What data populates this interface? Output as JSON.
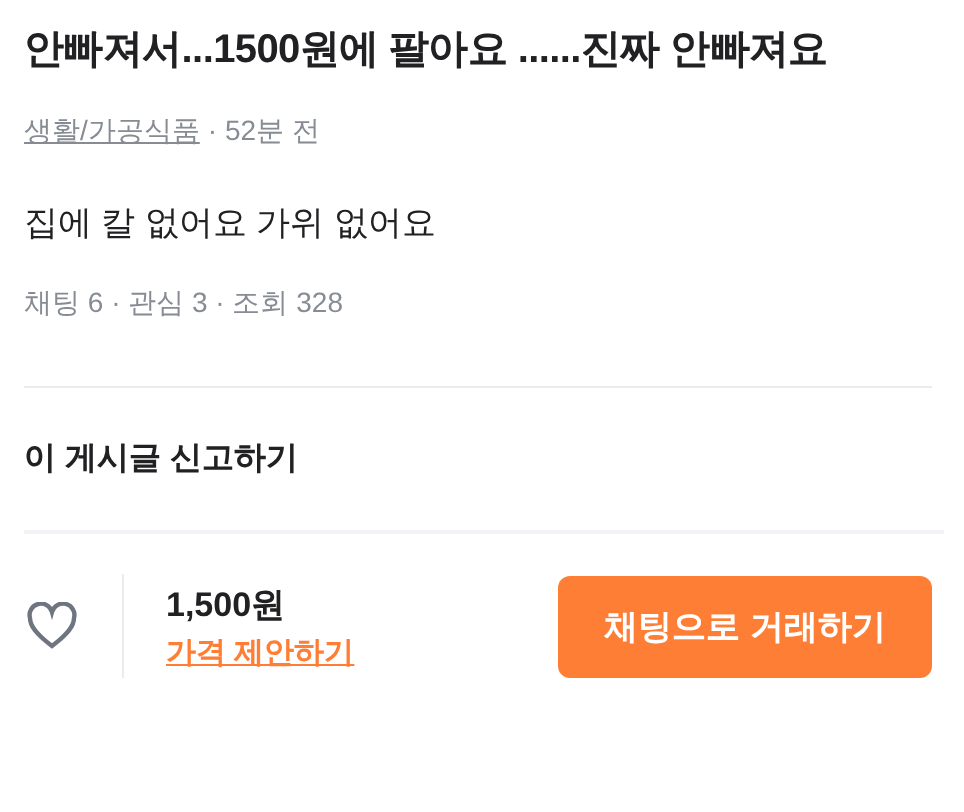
{
  "post": {
    "title": "안빠져서...1500원에 팔아요 ......진짜 안빠져요",
    "category": "생활/가공식품",
    "time": "· 52분 전",
    "description": "집에 칼 없어요 가위 없어요",
    "stats": "채팅 6 · 관심 3 · 조회 328"
  },
  "report": {
    "label": "이 게시글 신고하기"
  },
  "action_bar": {
    "liked": false,
    "price": "1,500원",
    "offer_link": "가격 제안하기",
    "chat_button": "채팅으로 거래하기"
  }
}
